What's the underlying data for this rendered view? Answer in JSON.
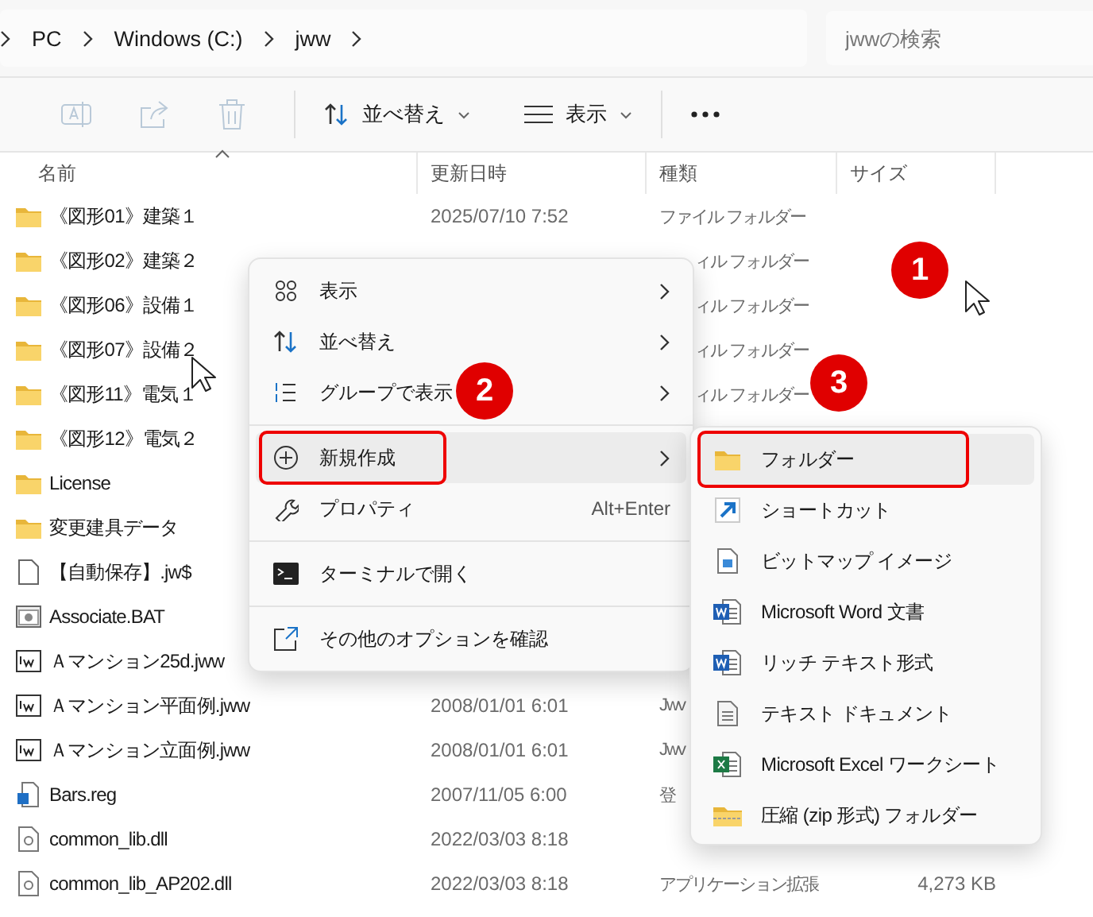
{
  "address_bar": {
    "crumbs": [
      "PC",
      "Windows (C:)",
      "jww"
    ]
  },
  "search": {
    "placeholder": "jwwの検索"
  },
  "toolbar": {
    "icon_buttons": [
      {
        "kind": "rename",
        "disabled": true
      },
      {
        "kind": "share",
        "disabled": true
      },
      {
        "kind": "delete",
        "disabled": true
      }
    ],
    "sort": {
      "label": "並べ替え"
    },
    "view": {
      "label": "表示"
    }
  },
  "file_list": {
    "columns": [
      "名前",
      "更新日時",
      "種類",
      "サイズ"
    ],
    "rows": [
      {
        "name": "《図形01》建築１",
        "kind": "folder",
        "date": "2025/07/10 7:52",
        "type": "ファイル フォルダー"
      },
      {
        "name": "《図形02》建築２",
        "kind": "folder",
        "type": "ィル フォルダー"
      },
      {
        "name": "《図形06》設備１",
        "kind": "folder",
        "type": "ィル フォルダー"
      },
      {
        "name": "《図形07》設備２",
        "kind": "folder",
        "type": "ィル フォルダー"
      },
      {
        "name": "《図形11》電気１",
        "kind": "folder",
        "type": "ィル フォルダー"
      },
      {
        "name": "《図形12》電気２",
        "kind": "folder"
      },
      {
        "name": "License",
        "kind": "folder"
      },
      {
        "name": "変更建具データ",
        "kind": "folder"
      },
      {
        "name": "【自動保存】.jw$",
        "kind": "file"
      },
      {
        "name": "Associate.BAT",
        "kind": "bat"
      },
      {
        "name": "Ａマンション25d.jww",
        "kind": "jww"
      },
      {
        "name": "Ａマンション平面例.jww",
        "kind": "jww",
        "date": "2008/01/01 6:01",
        "type": "Jwv"
      },
      {
        "name": "Ａマンション立面例.jww",
        "kind": "jww",
        "date": "2008/01/01 6:01",
        "type": "Jwv"
      },
      {
        "name": "Bars.reg",
        "kind": "reg",
        "date": "2007/11/05 6:00",
        "type": "登"
      },
      {
        "name": "common_lib.dll",
        "kind": "dll",
        "date": "2022/03/03 8:18"
      },
      {
        "name": "common_lib_AP202.dll",
        "kind": "dll",
        "date": "2022/03/03 8:18",
        "type": "アプリケーション拡張",
        "size": "4,273 KB"
      }
    ]
  },
  "context_menu": {
    "groups": [
      [
        {
          "label": "表示",
          "kind": "grid",
          "submenu": true,
          "selected": false,
          "highlighted": false
        },
        {
          "label": "並べ替え",
          "kind": "sort",
          "submenu": true,
          "selected": false,
          "highlighted": false
        },
        {
          "label": "グループで表示",
          "kind": "group",
          "submenu": true,
          "selected": false,
          "highlighted": false
        }
      ],
      [
        {
          "label": "新規作成",
          "kind": "plus",
          "submenu": true,
          "selected": true,
          "highlighted": true
        },
        {
          "label": "プロパティ",
          "kind": "wrench",
          "shortcut": "Alt+Enter",
          "submenu": false,
          "selected": false,
          "highlighted": false
        }
      ],
      [
        {
          "label": "ターミナルで開く",
          "kind": "terminal",
          "submenu": false,
          "selected": false,
          "highlighted": false
        }
      ],
      [
        {
          "label": "その他のオプションを確認",
          "kind": "external",
          "submenu": false,
          "selected": false,
          "highlighted": false
        }
      ]
    ]
  },
  "new_submenu": {
    "items": [
      {
        "label": "フォルダー",
        "kind": "folder",
        "selected": true,
        "highlighted": true
      },
      {
        "label": "ショートカット",
        "kind": "shortcut",
        "selected": false,
        "highlighted": false
      },
      {
        "label": "ビットマップ イメージ",
        "kind": "bitmap",
        "selected": false,
        "highlighted": false
      },
      {
        "label": "Microsoft Word 文書",
        "kind": "word",
        "selected": false,
        "highlighted": false
      },
      {
        "label": "リッチ テキスト形式",
        "kind": "word",
        "selected": false,
        "highlighted": false
      },
      {
        "label": "テキスト ドキュメント",
        "kind": "text",
        "selected": false,
        "highlighted": false
      },
      {
        "label": "Microsoft Excel ワークシート",
        "kind": "excel",
        "selected": false,
        "highlighted": false
      },
      {
        "label": "圧縮 (zip 形式) フォルダー",
        "kind": "zip",
        "selected": false,
        "highlighted": false
      }
    ]
  },
  "step_badges": [
    "1",
    "2",
    "3"
  ]
}
